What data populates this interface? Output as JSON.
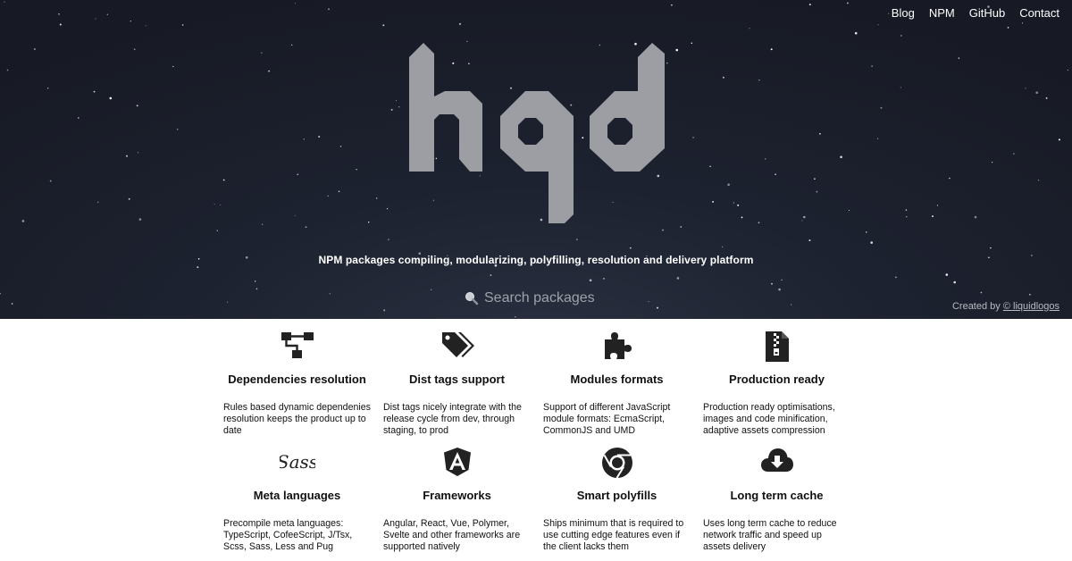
{
  "nav": {
    "links": [
      "Blog",
      "NPM",
      "GitHub",
      "Contact"
    ]
  },
  "logo": {
    "text": "hqd"
  },
  "hero": {
    "tagline": "NPM packages compiling, modularizing, polyfilling, resolution and delivery platform",
    "search_placeholder": "Search packages",
    "credit_prefix": "Created by",
    "credit_link": "© liquidlogos"
  },
  "features": [
    {
      "icon": "hierarchy-icon",
      "title": "Dependencies resolution",
      "text": "Rules based dynamic dependenies resolution keeps the product up to date"
    },
    {
      "icon": "tags-icon",
      "title": "Dist tags support",
      "text": "Dist tags nicely integrate with the release cycle from dev, through staging, to prod"
    },
    {
      "icon": "puzzle-icon",
      "title": "Modules formats",
      "text": "Support of different JavaScript module formats: EcmaScript, CommonJS and UMD"
    },
    {
      "icon": "zip-file-icon",
      "title": "Production ready",
      "text": "Production ready optimisations, images and code minification, adaptive assets compression"
    },
    {
      "icon": "sass-icon",
      "title": "Meta languages",
      "text": "Precompile meta languages: TypeScript, CofeeScript, J/Tsx, Scss, Sass, Less and Pug"
    },
    {
      "icon": "angular-icon",
      "title": "Frameworks",
      "text": "Angular, React, Vue, Polymer, Svelte and other frameworks are supported natively"
    },
    {
      "icon": "chrome-icon",
      "title": "Smart polyfills",
      "text": "Ships minimum that is required to use cutting edge features even if the client lacks them"
    },
    {
      "icon": "cloud-download-icon",
      "title": "Long term cache",
      "text": "Uses long term cache to reduce network traffic and speed up assets delivery"
    }
  ],
  "colors": {
    "hero_bg": "#1d2230",
    "logo": "#9c9ea3",
    "text": "#111111"
  }
}
